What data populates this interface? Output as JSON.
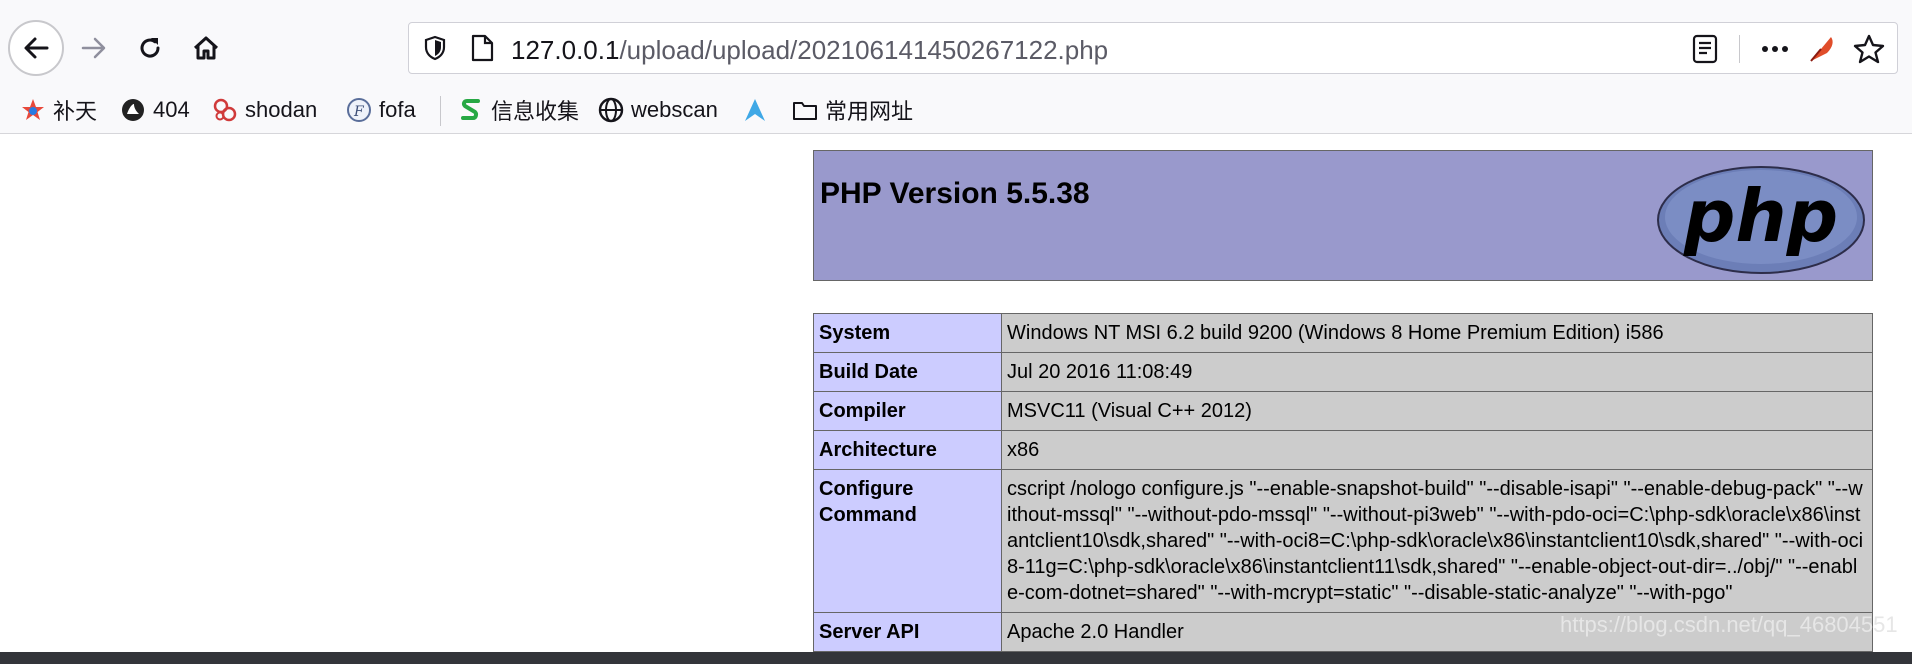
{
  "browser": {
    "url": {
      "host": "127.0.0.1",
      "path": "/upload/upload/20210614145026­7122.php"
    },
    "bookmarks": [
      {
        "label": "补天",
        "icon": "butian-icon"
      },
      {
        "label": "404",
        "icon": "404-icon"
      },
      {
        "label": "shodan",
        "icon": "shodan-icon"
      },
      {
        "label": "fofa",
        "icon": "fofa-icon"
      },
      {
        "label": "信息收集",
        "icon": "green-s-icon"
      },
      {
        "label": "webscan",
        "icon": "globe-icon"
      },
      {
        "label": "",
        "icon": "arrow-logo-icon"
      },
      {
        "label": "常用网址",
        "icon": "folder-icon"
      }
    ]
  },
  "phpinfo": {
    "title": "PHP Version 5.5.38",
    "logo_text": "php",
    "rows": [
      {
        "key": "System",
        "value": "Windows NT MSI 6.2 build 9200 (Windows 8 Home Premium Edition) i586"
      },
      {
        "key": "Build Date",
        "value": "Jul 20 2016 11:08:49"
      },
      {
        "key": "Compiler",
        "value": "MSVC11 (Visual C++ 2012)"
      },
      {
        "key": "Architecture",
        "value": "x86"
      },
      {
        "key": "Configure Command",
        "value": "cscript /nologo configure.js \"--enable-snapshot-build\" \"--disable-isapi\" \"--enable-debug-pack\" \"--without-mssql\" \"--without-pdo-mssql\" \"--without-pi3web\" \"--with-pdo-oci=C:\\php-sdk\\oracle\\x86\\instantclient10\\sdk,shared\" \"--with-oci8=C:\\php-sdk\\oracle\\x86\\instantclient10\\sdk,shared\" \"--with-oci8-11g=C:\\php-sdk\\oracle\\x86\\instantclient11\\sdk,shared\" \"--enable-object-out-dir=../obj/\" \"--enable-com-dotnet=shared\" \"--with-mcrypt=static\" \"--disable-static-analyze\" \"--with-pgo\""
      },
      {
        "key": "Server API",
        "value": "Apache 2.0 Handler"
      }
    ]
  },
  "watermark": "https://blog.csdn.net/qq_46804551",
  "colors": {
    "header_bg": "#9999cc",
    "key_bg": "#ccccff",
    "value_bg": "#cccccc"
  }
}
